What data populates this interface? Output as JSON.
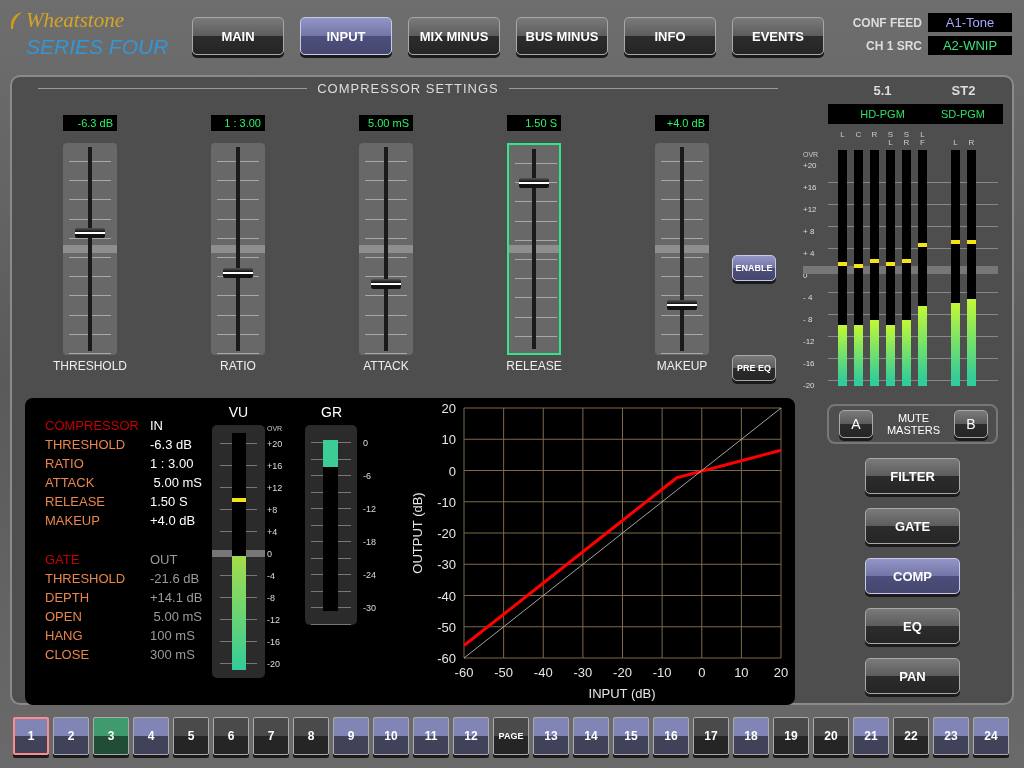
{
  "header": {
    "brand": "Wheatstone",
    "product": "SERIES FOUR",
    "tabs": [
      {
        "label": "MAIN",
        "selected": false
      },
      {
        "label": "INPUT",
        "selected": true
      },
      {
        "label": "MIX MINUS",
        "selected": false
      },
      {
        "label": "BUS MINUS",
        "selected": false
      },
      {
        "label": "INFO",
        "selected": false
      },
      {
        "label": "EVENTS",
        "selected": false
      }
    ],
    "sources": [
      {
        "label": "CONF FEED",
        "value": "A1-Tone",
        "color": "#a9a6ff"
      },
      {
        "label": "CH 1 SRC",
        "value": "A2-WNIP",
        "color": "#3be37a"
      }
    ]
  },
  "compressor_settings": {
    "title": "COMPRESSOR SETTINGS",
    "faders": [
      {
        "label": "THRESHOLD",
        "reading": "-6.3 dB",
        "level": 0.58,
        "selected": false
      },
      {
        "label": "RATIO",
        "reading": "1 : 3.00",
        "level": 0.39,
        "selected": false
      },
      {
        "label": "ATTACK",
        "reading": "5.00 mS",
        "level": 0.34,
        "selected": false
      },
      {
        "label": "RELEASE",
        "reading": "1.50 S",
        "level": 0.82,
        "selected": true
      },
      {
        "label": "MAKEUP",
        "reading": "+4.0 dB",
        "level": 0.24,
        "selected": false
      }
    ],
    "toggles": [
      {
        "label": "ENABLE",
        "on": true
      },
      {
        "label": "PRE EQ",
        "on": false
      }
    ]
  },
  "analysis": {
    "sections": [
      {
        "title": "COMPRESSOR",
        "status": "IN",
        "on": true,
        "rows": [
          {
            "label": "THRESHOLD",
            "value": "-6.3 dB"
          },
          {
            "label": "RATIO",
            "value": "1 : 3.00"
          },
          {
            "label": "ATTACK",
            "value": " 5.00 mS"
          },
          {
            "label": "RELEASE",
            "value": "1.50 S"
          },
          {
            "label": "MAKEUP",
            "value": "+4.0 dB"
          }
        ]
      },
      {
        "title": "GATE",
        "status": "OUT",
        "on": false,
        "rows": [
          {
            "label": "THRESHOLD",
            "value": "-21.6 dB"
          },
          {
            "label": "DEPTH",
            "value": "+14.1 dB"
          },
          {
            "label": "OPEN",
            "value": " 5.00 mS"
          },
          {
            "label": "HANG",
            "value": "100 mS"
          },
          {
            "label": "CLOSE",
            "value": "300 mS"
          }
        ]
      }
    ],
    "vu": {
      "title": "VU",
      "level": 0.48,
      "peak": {
        "level": 0.71
      },
      "scale": [
        "OVR",
        "+20",
        "+16",
        "+12",
        "+8",
        "+4",
        "0",
        "-4",
        "-8",
        "-12",
        "-16",
        "-20"
      ]
    },
    "gr": {
      "title": "GR",
      "level": 0.16,
      "scale": [
        "0",
        "-6",
        "-12",
        "-18",
        "-24",
        "-30"
      ]
    },
    "chart": {
      "chart_data": {
        "type": "line",
        "xlabel": "INPUT (dB)",
        "ylabel": "OUTPUT (dB)",
        "x": [
          -60,
          -50,
          -40,
          -30,
          -20,
          -10,
          -6.3,
          0,
          10,
          20
        ],
        "series": [
          {
            "color": "#ff0000",
            "values": [
              -56,
              -46,
              -36,
              -26,
              -16,
              -6,
              -2.3,
              -0.2,
              3.1,
              6.5
            ]
          },
          {
            "color": "#cccccc",
            "values": [
              -60,
              -50,
              -40,
              -30,
              -20,
              -10,
              -6.3,
              0,
              10,
              20
            ]
          }
        ],
        "grid": true,
        "xlim": [
          -60,
          20
        ],
        "ylim": [
          -60,
          20
        ],
        "xticks": [
          -60,
          -50,
          -40,
          -30,
          -20,
          -10,
          0,
          10,
          20
        ],
        "yticks": [
          -60,
          -50,
          -40,
          -30,
          -20,
          -10,
          0,
          10,
          20
        ]
      }
    }
  },
  "meters": {
    "scale": [
      "OVR",
      "+20",
      "+16",
      "+12",
      "+ 8",
      "+ 4",
      "0",
      "- 4",
      "- 8",
      "-12",
      "-16",
      "-20"
    ],
    "groups": [
      {
        "title": "5.1",
        "label": "HD-PGM",
        "channels": [
          {
            "name": "L",
            "level": 0.26,
            "peak": {
              "level": 0.51
            }
          },
          {
            "name": "C",
            "level": 0.26,
            "peak": {
              "level": 0.5
            }
          },
          {
            "name": "R",
            "level": 0.28,
            "peak": {
              "level": 0.52
            }
          },
          {
            "name": "SL",
            "level": 0.26,
            "peak": {
              "level": 0.51
            }
          },
          {
            "name": "SR",
            "level": 0.28,
            "peak": {
              "level": 0.52
            }
          },
          {
            "name": "LF",
            "level": 0.34,
            "peak": {
              "level": 0.59
            }
          }
        ]
      },
      {
        "title": "ST2",
        "label": "SD-PGM",
        "channels": [
          {
            "name": "L",
            "level": 0.35,
            "peak": {
              "level": 0.6
            }
          },
          {
            "name": "R",
            "level": 0.37,
            "peak": {
              "level": 0.6
            }
          }
        ]
      }
    ],
    "mute_masters": {
      "label": "MUTE MASTERS",
      "buttons": [
        "A",
        "B"
      ]
    }
  },
  "modules": [
    {
      "label": "FILTER",
      "selected": false
    },
    {
      "label": "GATE",
      "selected": false
    },
    {
      "label": "COMP",
      "selected": true
    },
    {
      "label": "EQ",
      "selected": false
    },
    {
      "label": "PAN",
      "selected": false
    }
  ],
  "channels": [
    {
      "label": "1",
      "color": "#8185b5",
      "selected": true
    },
    {
      "label": "2",
      "color": "#8185b5",
      "selected": false
    },
    {
      "label": "3",
      "color": "#3f9a6c",
      "selected": false
    },
    {
      "label": "4",
      "color": "#8185b5",
      "selected": false
    },
    {
      "label": "5",
      "color": "#4a4a4a",
      "selected": false
    },
    {
      "label": "6",
      "color": "#4a4a4a",
      "selected": false
    },
    {
      "label": "7",
      "color": "#4a4a4a",
      "selected": false
    },
    {
      "label": "8",
      "color": "#4a4a4a",
      "selected": false
    },
    {
      "label": "9",
      "color": "#8185b5",
      "selected": false
    },
    {
      "label": "10",
      "color": "#8185b5",
      "selected": false
    },
    {
      "label": "11",
      "color": "#8185b5",
      "selected": false
    },
    {
      "label": "12",
      "color": "#8185b5",
      "selected": false
    },
    {
      "label": "PAGE",
      "color": "#4a4a4a",
      "selected": false
    },
    {
      "label": "13",
      "color": "#8185b5",
      "selected": false
    },
    {
      "label": "14",
      "color": "#8185b5",
      "selected": false
    },
    {
      "label": "15",
      "color": "#8185b5",
      "selected": false
    },
    {
      "label": "16",
      "color": "#8185b5",
      "selected": false
    },
    {
      "label": "17",
      "color": "#4a4a4a",
      "selected": false
    },
    {
      "label": "18",
      "color": "#8185b5",
      "selected": false
    },
    {
      "label": "19",
      "color": "#4a4a4a",
      "selected": false
    },
    {
      "label": "20",
      "color": "#4a4a4a",
      "selected": false
    },
    {
      "label": "21",
      "color": "#8185b5",
      "selected": false
    },
    {
      "label": "22",
      "color": "#4a4a4a",
      "selected": false
    },
    {
      "label": "23",
      "color": "#8185b5",
      "selected": false
    },
    {
      "label": "24",
      "color": "#8185b5",
      "selected": false
    }
  ]
}
